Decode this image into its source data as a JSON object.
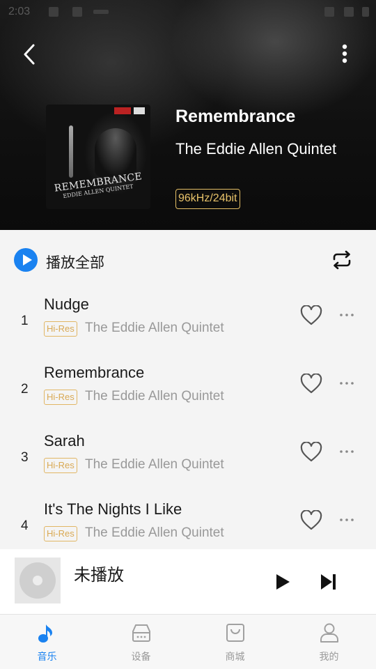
{
  "status_bar": {
    "time": "2:03"
  },
  "album": {
    "title": "Remembrance",
    "artist": "The Eddie Allen Quintet",
    "quality": "96kHz/24bit",
    "cover_text": "REMEMBRANCE",
    "cover_subtext": "EDDIE ALLEN QUINTET"
  },
  "play_all": {
    "label": "播放全部"
  },
  "tracks": [
    {
      "number": "1",
      "title": "Nudge",
      "badge": "Hi-Res",
      "artist": "The Eddie Allen Quintet"
    },
    {
      "number": "2",
      "title": "Remembrance",
      "badge": "Hi-Res",
      "artist": "The Eddie Allen Quintet"
    },
    {
      "number": "3",
      "title": "Sarah",
      "badge": "Hi-Res",
      "artist": "The Eddie Allen Quintet"
    },
    {
      "number": "4",
      "title": "It's The Nights I Like",
      "badge": "Hi-Res",
      "artist": "The Eddie Allen Quintet"
    }
  ],
  "mini_player": {
    "title": "未播放"
  },
  "nav": [
    {
      "label": "音乐",
      "icon": "music-note-icon",
      "active": true
    },
    {
      "label": "设备",
      "icon": "device-icon",
      "active": false
    },
    {
      "label": "商城",
      "icon": "shopping-bag-icon",
      "active": false
    },
    {
      "label": "我的",
      "icon": "person-icon",
      "active": false
    }
  ],
  "colors": {
    "accent": "#1a82f0",
    "hires_badge": "#e1b664",
    "quality_badge": "#e6c066"
  }
}
